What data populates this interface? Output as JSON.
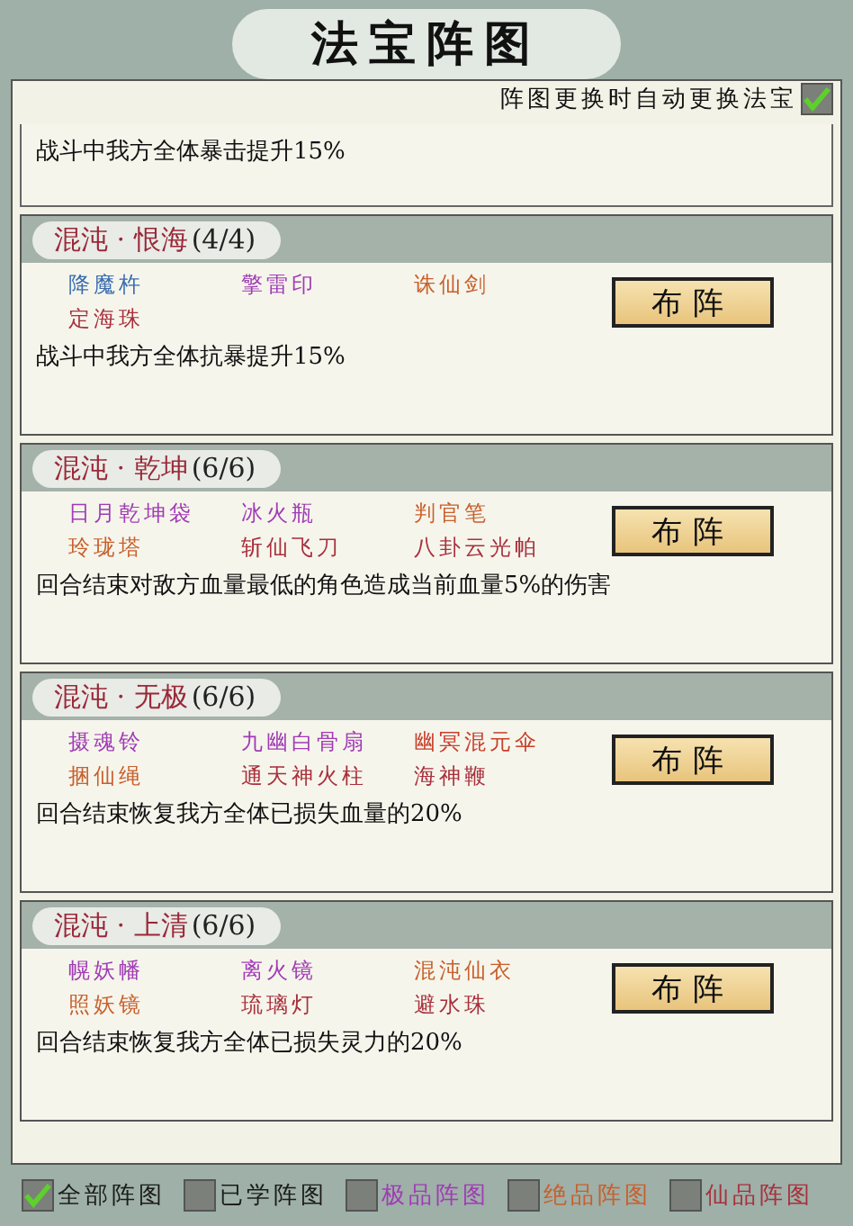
{
  "window": {
    "title": "法宝阵图"
  },
  "auto_switch": {
    "label": "阵图更换时自动更换法宝",
    "checked": true
  },
  "top_card": {
    "effect": "战斗中我方全体暴击提升15%"
  },
  "formations": [
    {
      "name": "混沌 · 恨海",
      "count": "(4/4)",
      "button": "布阵",
      "effect": "战斗中我方全体抗暴提升15%",
      "items": [
        {
          "name": "降魔杵",
          "color": "#3a6db0"
        },
        {
          "name": "擎雷印",
          "color": "#a03cb4"
        },
        {
          "name": "诛仙剑",
          "color": "#c8602c"
        },
        {
          "name": "定海珠",
          "color": "#a8303c"
        }
      ]
    },
    {
      "name": "混沌 · 乾坤",
      "count": "(6/6)",
      "button": "布阵",
      "effect": "回合结束对敌方血量最低的角色造成当前血量5%的伤害",
      "items": [
        {
          "name": "日月乾坤袋",
          "color": "#a03cb4"
        },
        {
          "name": "冰火瓶",
          "color": "#a03cb4"
        },
        {
          "name": "判官笔",
          "color": "#c8602c"
        },
        {
          "name": "玲珑塔",
          "color": "#c8602c"
        },
        {
          "name": "斩仙飞刀",
          "color": "#a8303c"
        },
        {
          "name": "八卦云光帕",
          "color": "#a8303c"
        }
      ]
    },
    {
      "name": "混沌 · 无极",
      "count": "(6/6)",
      "button": "布阵",
      "effect": "回合结束恢复我方全体已损失血量的20%",
      "items": [
        {
          "name": "摄魂铃",
          "color": "#a03cb4"
        },
        {
          "name": "九幽白骨扇",
          "color": "#a03cb4"
        },
        {
          "name": "幽冥混元伞",
          "color": "#c8402c"
        },
        {
          "name": "捆仙绳",
          "color": "#c8602c"
        },
        {
          "name": "通天神火柱",
          "color": "#a8303c"
        },
        {
          "name": "海神鞭",
          "color": "#a8303c"
        }
      ]
    },
    {
      "name": "混沌 · 上清",
      "count": "(6/6)",
      "button": "布阵",
      "effect": "回合结束恢复我方全体已损失灵力的20%",
      "items": [
        {
          "name": "幌妖幡",
          "color": "#a03cb4"
        },
        {
          "name": "离火镜",
          "color": "#a03cb4"
        },
        {
          "name": "混沌仙衣",
          "color": "#c8602c"
        },
        {
          "name": "照妖镜",
          "color": "#c8602c"
        },
        {
          "name": "琉璃灯",
          "color": "#a8303c"
        },
        {
          "name": "避水珠",
          "color": "#a8303c"
        }
      ]
    }
  ],
  "filters": [
    {
      "label": "全部阵图",
      "checked": true,
      "color": "#1a1a1a"
    },
    {
      "label": "已学阵图",
      "checked": false,
      "color": "#1a1a1a"
    },
    {
      "label": "极品阵图",
      "checked": false,
      "color": "#a03cb4"
    },
    {
      "label": "绝品阵图",
      "checked": false,
      "color": "#c8602c"
    },
    {
      "label": "仙品阵图",
      "checked": false,
      "color": "#a8303c"
    }
  ]
}
